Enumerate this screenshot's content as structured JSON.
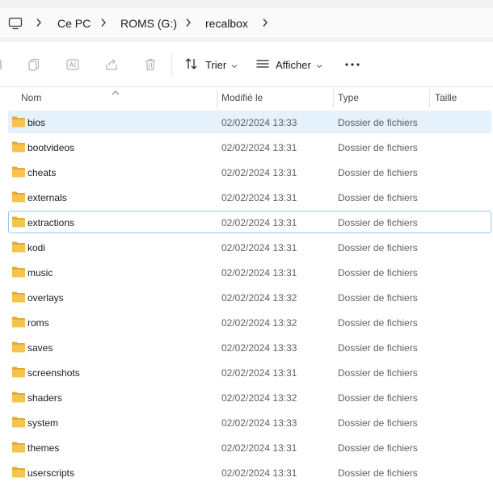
{
  "breadcrumb": {
    "items": [
      "Ce PC",
      "ROMS (G:)",
      "recalbox"
    ]
  },
  "toolbar": {
    "sort_label": "Trier",
    "view_label": "Afficher"
  },
  "columns": {
    "name": "Nom",
    "modified": "Modifié le",
    "type": "Type",
    "size": "Taille"
  },
  "colors": {
    "folder": "#f4c44f",
    "selection": "#e5f1fb",
    "focus_border": "#99c9ef"
  },
  "files": [
    {
      "name": "bios",
      "modified": "02/02/2024 13:33",
      "type": "Dossier de fichiers"
    },
    {
      "name": "bootvideos",
      "modified": "02/02/2024 13:31",
      "type": "Dossier de fichiers"
    },
    {
      "name": "cheats",
      "modified": "02/02/2024 13:31",
      "type": "Dossier de fichiers"
    },
    {
      "name": "externals",
      "modified": "02/02/2024 13:31",
      "type": "Dossier de fichiers"
    },
    {
      "name": "extractions",
      "modified": "02/02/2024 13:31",
      "type": "Dossier de fichiers"
    },
    {
      "name": "kodi",
      "modified": "02/02/2024 13:31",
      "type": "Dossier de fichiers"
    },
    {
      "name": "music",
      "modified": "02/02/2024 13:31",
      "type": "Dossier de fichiers"
    },
    {
      "name": "overlays",
      "modified": "02/02/2024 13:32",
      "type": "Dossier de fichiers"
    },
    {
      "name": "roms",
      "modified": "02/02/2024 13:32",
      "type": "Dossier de fichiers"
    },
    {
      "name": "saves",
      "modified": "02/02/2024 13:33",
      "type": "Dossier de fichiers"
    },
    {
      "name": "screenshots",
      "modified": "02/02/2024 13:31",
      "type": "Dossier de fichiers"
    },
    {
      "name": "shaders",
      "modified": "02/02/2024 13:32",
      "type": "Dossier de fichiers"
    },
    {
      "name": "system",
      "modified": "02/02/2024 13:33",
      "type": "Dossier de fichiers"
    },
    {
      "name": "themes",
      "modified": "02/02/2024 13:31",
      "type": "Dossier de fichiers"
    },
    {
      "name": "userscripts",
      "modified": "02/02/2024 13:31",
      "type": "Dossier de fichiers"
    }
  ]
}
